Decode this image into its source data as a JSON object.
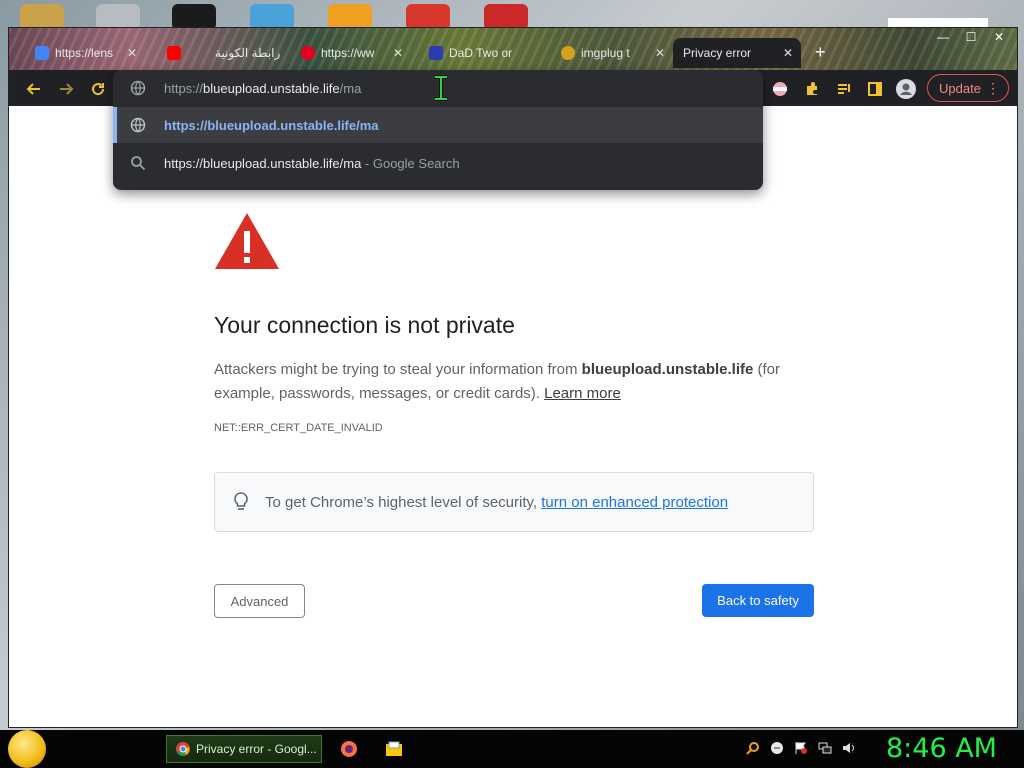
{
  "tabs": [
    {
      "label": "https://lens"
    },
    {
      "label": ""
    },
    {
      "label": "رابطة الكونية"
    },
    {
      "label": "https://ww"
    },
    {
      "label": "DaD Two or"
    },
    {
      "label": "imgplug t"
    },
    {
      "label": "Privacy error"
    }
  ],
  "tab_close": "✕",
  "new_tab": "+",
  "window_controls": {
    "minimize": "—",
    "maximize": "☐",
    "close": "✕"
  },
  "toolbar": {
    "update_label": "Update",
    "menu_dots": "⋮"
  },
  "omnibox": {
    "input_prefix": "https://",
    "input_host": "blueupload.unstable.life",
    "input_suffix": "/ma",
    "suggestion_url": "https://blueupload.unstable.life/ma",
    "search_query": "https://blueupload.unstable.life/ma",
    "search_hint": " - Google Search"
  },
  "page": {
    "title": "Your connection is not private",
    "desc_before": "Attackers might be trying to steal your information from ",
    "desc_host": "blueupload.unstable.life",
    "desc_after": " (for example, passwords, messages, or credit cards). ",
    "learn_more": "Learn more",
    "error_code": "NET::ERR_CERT_DATE_INVALID",
    "enhanced_text": "To get Chrome’s highest level of security, ",
    "enhanced_link": "turn on enhanced protection",
    "advanced_label": "Advanced",
    "back_label": "Back to safety"
  },
  "taskbar": {
    "task_label": "Privacy error - Googl...",
    "clock": "8:46 AM"
  },
  "colors": {
    "primary_button": "#1a73e8",
    "warning_red": "#d93025",
    "clock_green": "#23f046",
    "update_red": "#e2584c"
  }
}
